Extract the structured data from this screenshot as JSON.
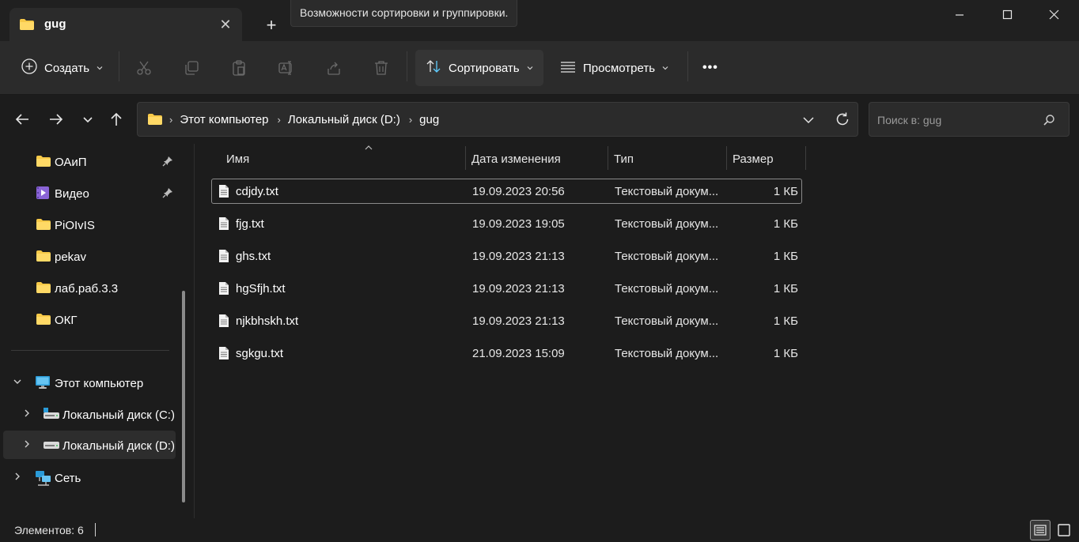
{
  "tab": {
    "title": "gug",
    "close": "✕",
    "new": "+"
  },
  "tooltip": "Возможности сортировки и группировки.",
  "commands": {
    "create": "Создать",
    "sort": "Сортировать",
    "view": "Просмотреть",
    "more": "•••"
  },
  "address": {
    "crumbs": [
      "Этот компьютер",
      "Локальный диск (D:)",
      "gug"
    ],
    "separator": "›"
  },
  "search": {
    "placeholder": "Поиск в: gug"
  },
  "sidebar": {
    "pinned": [
      {
        "label": "ОАиП",
        "icon": "folder-icon",
        "pinned": true
      },
      {
        "label": "Видео",
        "icon": "video-folder-icon",
        "pinned": true
      },
      {
        "label": "PiOIvIS",
        "icon": "folder-icon",
        "pinned": false
      },
      {
        "label": "pekav",
        "icon": "folder-icon",
        "pinned": false
      },
      {
        "label": "лаб.раб.3.3",
        "icon": "folder-icon",
        "pinned": false
      },
      {
        "label": "ОКГ",
        "icon": "folder-icon",
        "pinned": false
      }
    ],
    "this_pc": "Этот компьютер",
    "drive_c": "Локальный диск (C:)",
    "drive_d": "Локальный диск (D:)",
    "network": "Сеть"
  },
  "columns": {
    "name": "Имя",
    "date": "Дата изменения",
    "type": "Тип",
    "size": "Размер"
  },
  "files": [
    {
      "name": "cdjdy.txt",
      "date": "19.09.2023 20:56",
      "type": "Текстовый докум...",
      "size": "1 КБ"
    },
    {
      "name": "fjg.txt",
      "date": "19.09.2023 19:05",
      "type": "Текстовый докум...",
      "size": "1 КБ"
    },
    {
      "name": "ghs.txt",
      "date": "19.09.2023 21:13",
      "type": "Текстовый докум...",
      "size": "1 КБ"
    },
    {
      "name": "hgSfjh.txt",
      "date": "19.09.2023 21:13",
      "type": "Текстовый докум...",
      "size": "1 КБ"
    },
    {
      "name": "njkbhskh.txt",
      "date": "19.09.2023 21:13",
      "type": "Текстовый докум...",
      "size": "1 КБ"
    },
    {
      "name": "sgkgu.txt",
      "date": "21.09.2023 15:09",
      "type": "Текстовый докум...",
      "size": "1 КБ"
    }
  ],
  "status": {
    "items": "Элементов: 6"
  },
  "colors": {
    "accent": "#60cdff",
    "folder": "#f7c948",
    "background": "#1c1c1c",
    "toolbar": "#2b2b2b"
  }
}
